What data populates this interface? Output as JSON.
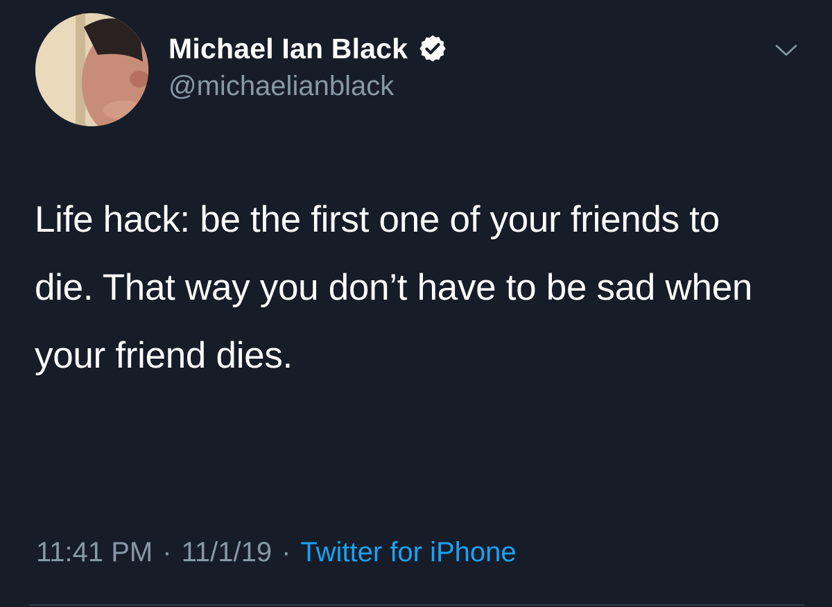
{
  "tweet": {
    "author": {
      "display_name": "Michael Ian Black",
      "handle": "@michaelianblack",
      "verified_icon": "verified-badge-icon"
    },
    "menu_icon": "chevron-down-icon",
    "text": "Life hack: be the first one of your friends to die. That way you don’t have to be sad when your friend dies.",
    "time": "11:41 PM",
    "date": "11/1/19",
    "separator": "·",
    "source": "Twitter for iPhone"
  },
  "colors": {
    "background": "#161d29",
    "primary_text": "#ffffff",
    "secondary_text": "#8899a6",
    "link": "#1da1f2"
  }
}
